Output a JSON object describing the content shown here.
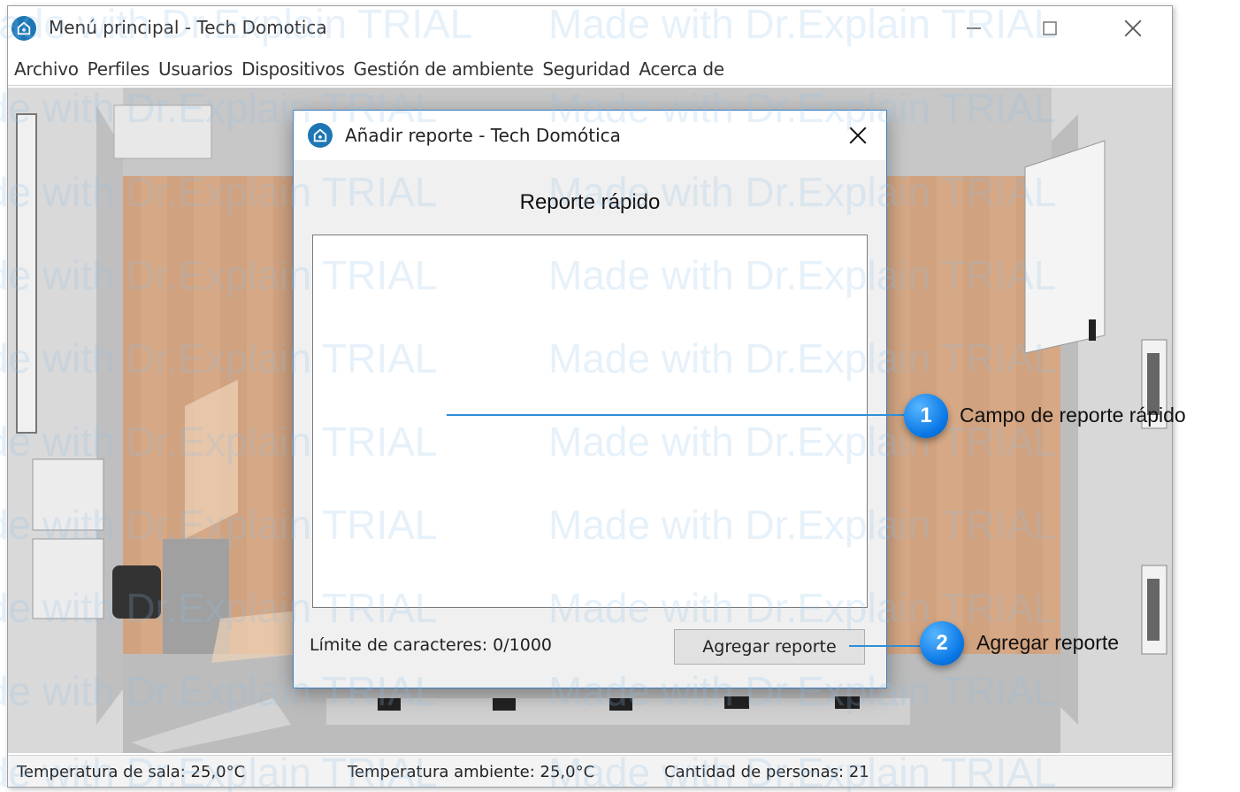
{
  "main_window": {
    "title": "Menú principal - Tech Domotica",
    "menu": [
      "Archivo",
      "Perfiles",
      "Usuarios",
      "Dispositivos",
      "Gestión de ambiente",
      "Seguridad",
      "Acerca de"
    ]
  },
  "status_bar": {
    "room_temperature": "Temperatura de sala: 25,0°C",
    "ambient_temperature": "Temperatura ambiente: 25,0°C",
    "people_count": "Cantidad de personas: 21"
  },
  "dialog": {
    "title": "Añadir reporte - Tech Domótica",
    "heading": "Reporte rápido",
    "report_value": "",
    "char_limit": "Límite de caracteres: 0/1000",
    "add_button_label": "Agregar reporte"
  },
  "callouts": [
    {
      "number": "1",
      "label": "Campo de reporte rápido"
    },
    {
      "number": "2",
      "label": "Agregar reporte"
    }
  ],
  "watermark_text": "Made with Dr.Explain TRIAL",
  "colors": {
    "accent": "#1e77b5",
    "callout_badge": "#0a78e6",
    "dialog_border": "#3f7fc2"
  },
  "icons": [
    "app-logo-icon",
    "minimize-icon",
    "maximize-icon",
    "close-icon"
  ]
}
